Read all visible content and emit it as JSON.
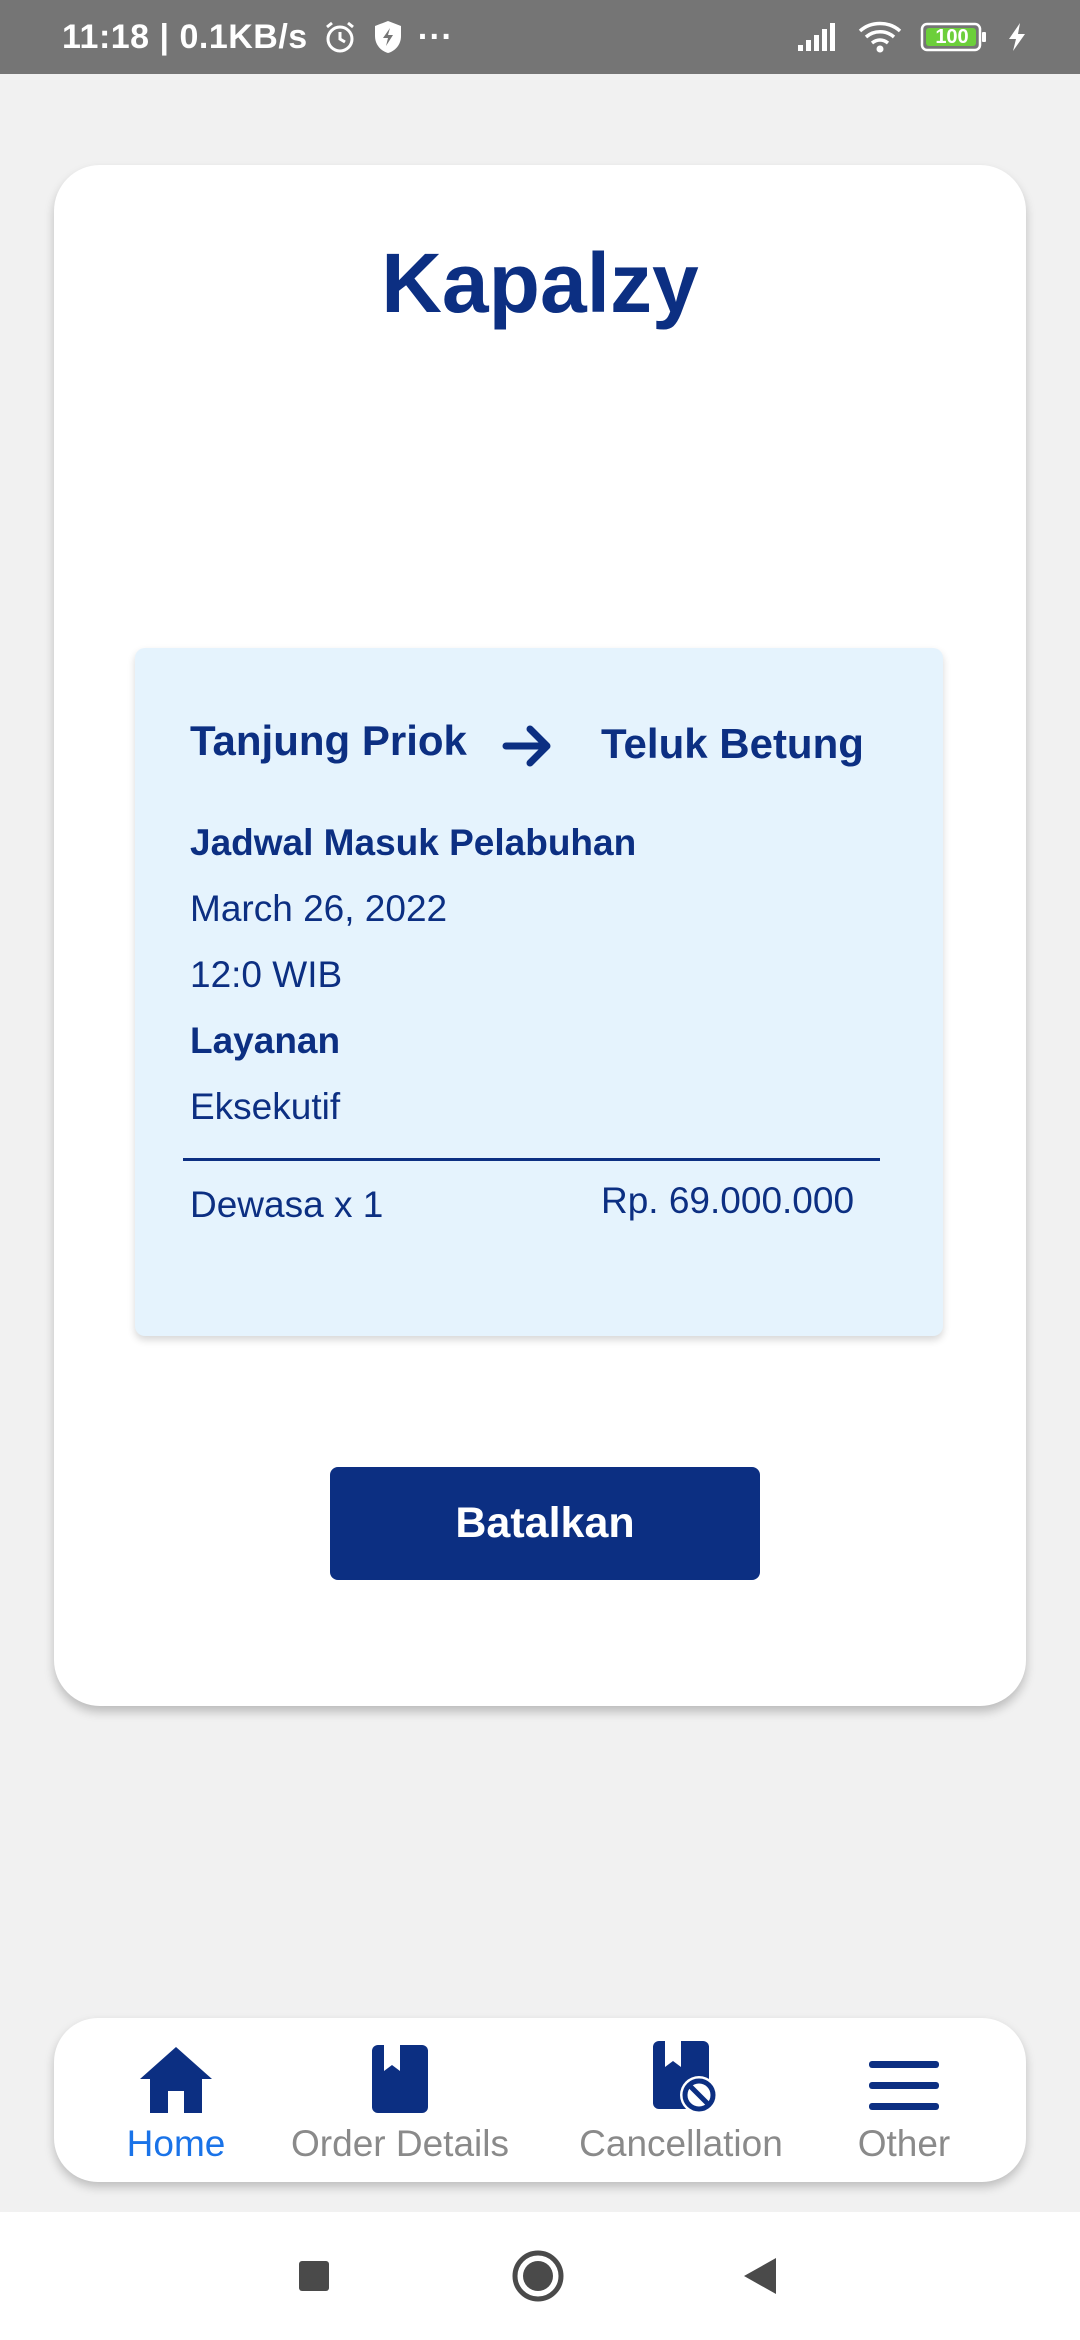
{
  "status_bar": {
    "time_speed": "11:18 | 0.1KB/s",
    "more": "···",
    "battery": "100"
  },
  "app": {
    "title": "Kapalzy"
  },
  "ticket": {
    "origin": "Tanjung Priok",
    "destination": "Teluk Betung",
    "schedule_label": "Jadwal Masuk Pelabuhan",
    "date": "March 26, 2022",
    "time": "12:0 WIB",
    "service_label": "Layanan",
    "service": "Eksekutif",
    "passenger": "Dewasa x 1",
    "price": "Rp. 69.000.000"
  },
  "actions": {
    "cancel_label": "Batalkan"
  },
  "bottom_nav": {
    "items": [
      {
        "label": "Home",
        "icon": "home-icon",
        "active": true
      },
      {
        "label": "Order Details",
        "icon": "bookmark-icon",
        "active": false
      },
      {
        "label": "Cancellation",
        "icon": "bookmark-cancel-icon",
        "active": false
      },
      {
        "label": "Other",
        "icon": "menu-icon",
        "active": false
      }
    ]
  },
  "colors": {
    "primary": "#0c2f82",
    "active_nav": "#1a73e8",
    "ticket_bg": "#e5f3fd",
    "status_bar": "#757575"
  }
}
